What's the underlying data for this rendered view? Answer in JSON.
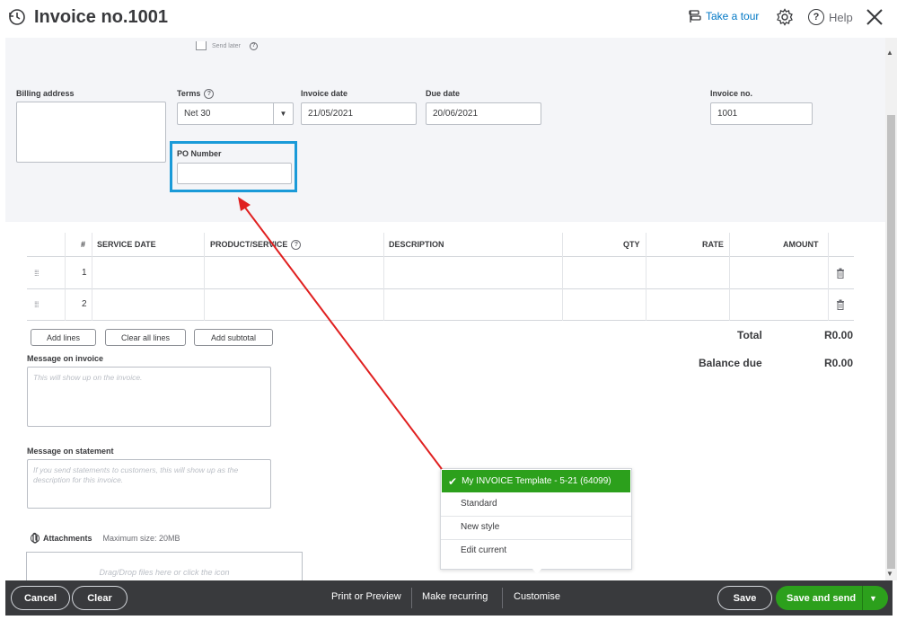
{
  "header": {
    "title": "Invoice no.1001",
    "take_tour": "Take a tour",
    "help": "Help"
  },
  "form": {
    "send_later": "Send later",
    "billing_address_label": "Billing address",
    "billing_address_value": "",
    "terms_label": "Terms",
    "terms_value": "Net 30",
    "invoice_date_label": "Invoice date",
    "invoice_date_value": "21/05/2021",
    "due_date_label": "Due date",
    "due_date_value": "20/06/2021",
    "invoice_no_label": "Invoice no.",
    "invoice_no_value": "1001",
    "po_number_label": "PO Number",
    "po_number_value": ""
  },
  "table": {
    "headers": [
      "#",
      "SERVICE DATE",
      "PRODUCT/SERVICE",
      "DESCRIPTION",
      "QTY",
      "RATE",
      "AMOUNT"
    ],
    "rows": [
      {
        "num": "1",
        "service_date": "",
        "product": "",
        "description": "",
        "qty": "",
        "rate": "",
        "amount": ""
      },
      {
        "num": "2",
        "service_date": "",
        "product": "",
        "description": "",
        "qty": "",
        "rate": "",
        "amount": ""
      }
    ]
  },
  "buttons": {
    "add_lines": "Add lines",
    "clear_all_lines": "Clear all lines",
    "add_subtotal": "Add subtotal"
  },
  "totals": {
    "total_label": "Total",
    "total_value": "R0.00",
    "balance_label": "Balance due",
    "balance_value": "R0.00"
  },
  "messages": {
    "invoice_label": "Message on invoice",
    "invoice_placeholder": "This will show up on the invoice.",
    "statement_label": "Message on statement",
    "statement_placeholder": "If you send statements to customers, this will show up as the description for this invoice."
  },
  "attachments": {
    "label": "Attachments",
    "max_size": "Maximum size: 20MB",
    "drop_text": "Drag/Drop files here or click the icon"
  },
  "template_menu": {
    "selected": "My INVOICE Template - 5-21 (64099)",
    "items": [
      "Standard",
      "New style",
      "Edit current"
    ]
  },
  "footer": {
    "cancel": "Cancel",
    "clear": "Clear",
    "print_preview": "Print or Preview",
    "make_recurring": "Make recurring",
    "customise": "Customise",
    "save": "Save",
    "save_and_send": "Save and send"
  },
  "colors": {
    "accent_green": "#2ca01c",
    "highlight_blue": "#1a9ad8",
    "annotation_red": "#e02020",
    "footer_bg": "#393a3d",
    "link_blue": "#0077c5"
  }
}
